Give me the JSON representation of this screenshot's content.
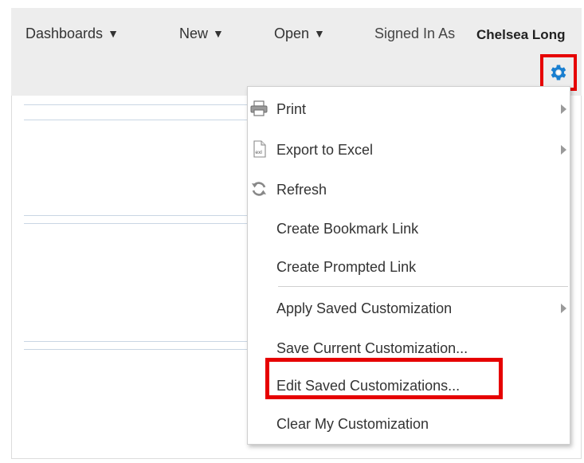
{
  "topbar": {
    "dashboards_label": "Dashboards",
    "new_label": "New",
    "open_label": "Open",
    "caret": "▼",
    "signed_in_label": "Signed In As",
    "user_name": "Chelsea Long"
  },
  "gear": {
    "icon": "gear-icon",
    "color": "#1a7fd0"
  },
  "menu": {
    "print": "Print",
    "export_excel": "Export to Excel",
    "refresh": "Refresh",
    "create_bookmark": "Create Bookmark Link",
    "create_prompted": "Create Prompted Link",
    "apply_saved": "Apply Saved Customization",
    "save_current": "Save Current Customization...",
    "edit_saved": "Edit Saved Customizations...",
    "clear_my": "Clear My Customization"
  },
  "colors": {
    "highlight": "#e60000",
    "header_bg": "#ededed"
  }
}
